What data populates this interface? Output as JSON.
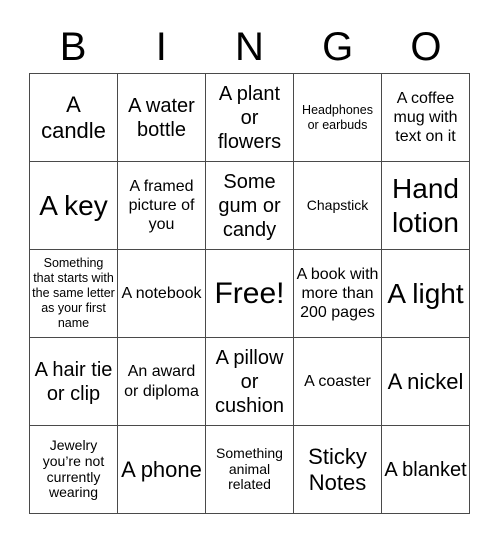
{
  "title_letters": [
    "B",
    "I",
    "N",
    "G",
    "O"
  ],
  "board": {
    "rows": [
      [
        {
          "text": "A candle",
          "size": "xxl-ish"
        },
        {
          "text": "A water bottle"
        },
        {
          "text": "A plant or flowers"
        },
        {
          "text": "Headphones or earbuds"
        },
        {
          "text": "A coffee mug with text on it"
        }
      ],
      [
        {
          "text": "A key"
        },
        {
          "text": "A framed picture of you"
        },
        {
          "text": "Some gum or candy"
        },
        {
          "text": "Chapstick"
        },
        {
          "text": "Hand lotion"
        }
      ],
      [
        {
          "text": "Something that starts with the same letter as your first name"
        },
        {
          "text": "A notebook"
        },
        {
          "text": "Free!"
        },
        {
          "text": "A book with more than 200 pages"
        },
        {
          "text": "A light"
        }
      ],
      [
        {
          "text": "A hair tie or clip"
        },
        {
          "text": "An award or diploma"
        },
        {
          "text": "A pillow or cushion"
        },
        {
          "text": "A coaster"
        },
        {
          "text": "A nickel"
        }
      ],
      [
        {
          "text": "Jewelry you’re not currently wearing"
        },
        {
          "text": "A phone"
        },
        {
          "text": "Something animal related"
        },
        {
          "text": "Sticky Notes"
        },
        {
          "text": "A blanket"
        }
      ]
    ]
  },
  "colors": {
    "grid_line": "#4a4a4a",
    "text": "#000000",
    "background": "#ffffff"
  }
}
